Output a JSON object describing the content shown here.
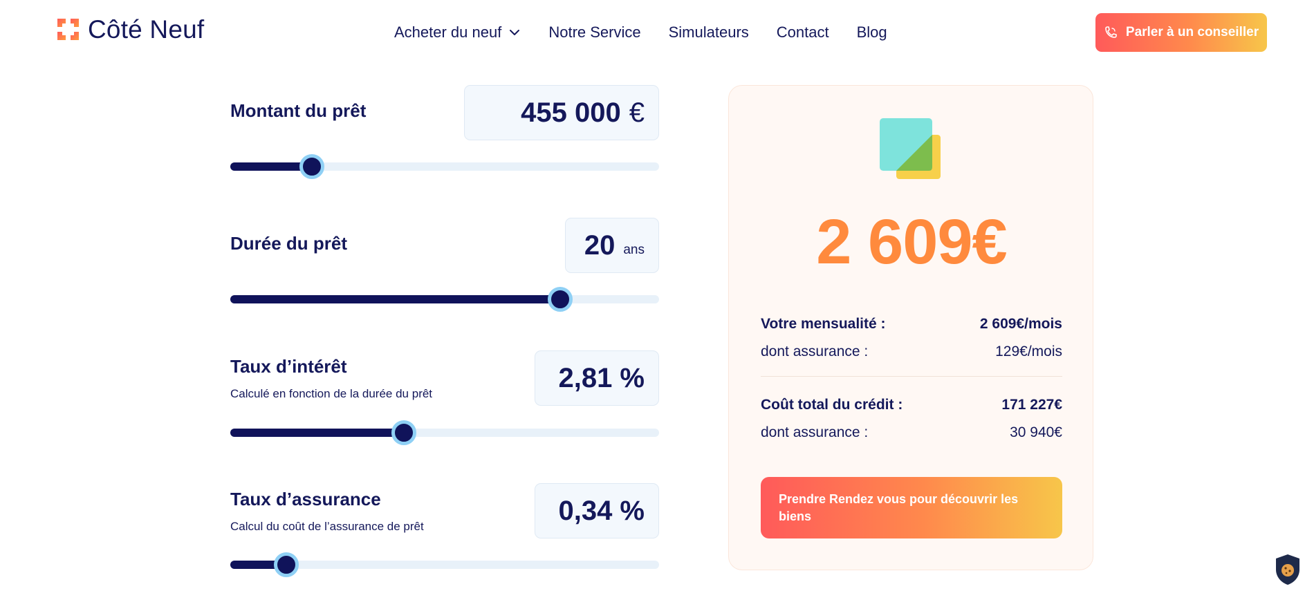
{
  "header": {
    "logo_text": "Côté Neuf",
    "nav": [
      {
        "label": "Acheter du neuf",
        "has_dropdown": true
      },
      {
        "label": "Notre Service"
      },
      {
        "label": "Simulateurs"
      },
      {
        "label": "Contact"
      },
      {
        "label": "Blog"
      }
    ],
    "cta_label": "Parler à un conseiller"
  },
  "sliders": [
    {
      "title": "Montant du prêt",
      "subtitle": "",
      "value": "455 000",
      "unit": "€",
      "level": 0.19
    },
    {
      "title": "Durée du prêt",
      "subtitle": "",
      "value": "20",
      "unit": "ans",
      "level": 0.77
    },
    {
      "title": "Taux d’intérêt",
      "subtitle": "Calculé en fonction de la durée du prêt",
      "value": "2,81 %",
      "unit": "",
      "level": 0.405
    },
    {
      "title": "Taux d’assurance",
      "subtitle": "Calcul du coût de l’assurance de prêt",
      "value": "0,34 %",
      "unit": "",
      "level": 0.13
    }
  ],
  "result": {
    "big_amount": "2 609€",
    "monthly_label": "Votre mensualité :",
    "monthly_value": "2 609€/mois",
    "monthly_ins_label": "dont assurance :",
    "monthly_ins_value": "129€/mois",
    "total_label": "Coût total du crédit :",
    "total_value": "171 227€",
    "total_ins_label": "dont assurance :",
    "total_ins_value": "30 940€",
    "cta_label": "Prendre Rendez vous pour découvrir les biens"
  },
  "colors": {
    "navy": "#14185a",
    "accent_orange": "#ff8a3d",
    "gradient_start": "#ff5a5a",
    "gradient_end": "#f7c64a",
    "slider_thumb_ring": "#8fd0f5"
  },
  "icons": [
    "logo-mark-icon",
    "chevron-down-icon",
    "phone-icon",
    "stacked-squares-icon",
    "cookie-shield-icon"
  ]
}
